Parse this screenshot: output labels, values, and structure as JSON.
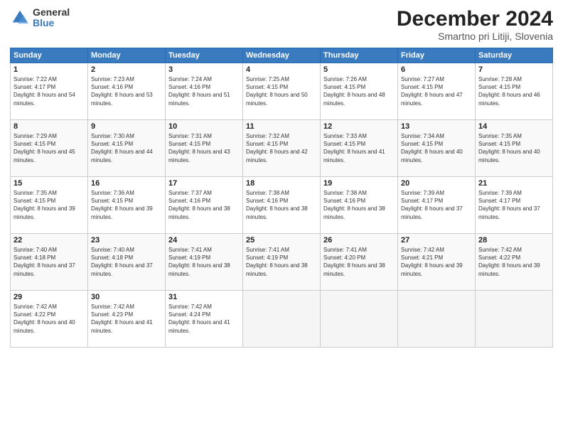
{
  "logo": {
    "general": "General",
    "blue": "Blue"
  },
  "header": {
    "month_year": "December 2024",
    "location": "Smartno pri Litiji, Slovenia"
  },
  "days_of_week": [
    "Sunday",
    "Monday",
    "Tuesday",
    "Wednesday",
    "Thursday",
    "Friday",
    "Saturday"
  ],
  "weeks": [
    [
      {
        "day": "1",
        "sunrise": "7:22 AM",
        "sunset": "4:17 PM",
        "daylight": "8 hours and 54 minutes."
      },
      {
        "day": "2",
        "sunrise": "7:23 AM",
        "sunset": "4:16 PM",
        "daylight": "8 hours and 53 minutes."
      },
      {
        "day": "3",
        "sunrise": "7:24 AM",
        "sunset": "4:16 PM",
        "daylight": "8 hours and 51 minutes."
      },
      {
        "day": "4",
        "sunrise": "7:25 AM",
        "sunset": "4:15 PM",
        "daylight": "8 hours and 50 minutes."
      },
      {
        "day": "5",
        "sunrise": "7:26 AM",
        "sunset": "4:15 PM",
        "daylight": "8 hours and 48 minutes."
      },
      {
        "day": "6",
        "sunrise": "7:27 AM",
        "sunset": "4:15 PM",
        "daylight": "8 hours and 47 minutes."
      },
      {
        "day": "7",
        "sunrise": "7:28 AM",
        "sunset": "4:15 PM",
        "daylight": "8 hours and 46 minutes."
      }
    ],
    [
      {
        "day": "8",
        "sunrise": "7:29 AM",
        "sunset": "4:15 PM",
        "daylight": "8 hours and 45 minutes."
      },
      {
        "day": "9",
        "sunrise": "7:30 AM",
        "sunset": "4:15 PM",
        "daylight": "8 hours and 44 minutes."
      },
      {
        "day": "10",
        "sunrise": "7:31 AM",
        "sunset": "4:15 PM",
        "daylight": "8 hours and 43 minutes."
      },
      {
        "day": "11",
        "sunrise": "7:32 AM",
        "sunset": "4:15 PM",
        "daylight": "8 hours and 42 minutes."
      },
      {
        "day": "12",
        "sunrise": "7:33 AM",
        "sunset": "4:15 PM",
        "daylight": "8 hours and 41 minutes."
      },
      {
        "day": "13",
        "sunrise": "7:34 AM",
        "sunset": "4:15 PM",
        "daylight": "8 hours and 40 minutes."
      },
      {
        "day": "14",
        "sunrise": "7:35 AM",
        "sunset": "4:15 PM",
        "daylight": "8 hours and 40 minutes."
      }
    ],
    [
      {
        "day": "15",
        "sunrise": "7:35 AM",
        "sunset": "4:15 PM",
        "daylight": "8 hours and 39 minutes."
      },
      {
        "day": "16",
        "sunrise": "7:36 AM",
        "sunset": "4:15 PM",
        "daylight": "8 hours and 39 minutes."
      },
      {
        "day": "17",
        "sunrise": "7:37 AM",
        "sunset": "4:16 PM",
        "daylight": "8 hours and 38 minutes."
      },
      {
        "day": "18",
        "sunrise": "7:38 AM",
        "sunset": "4:16 PM",
        "daylight": "8 hours and 38 minutes."
      },
      {
        "day": "19",
        "sunrise": "7:38 AM",
        "sunset": "4:16 PM",
        "daylight": "8 hours and 38 minutes."
      },
      {
        "day": "20",
        "sunrise": "7:39 AM",
        "sunset": "4:17 PM",
        "daylight": "8 hours and 37 minutes."
      },
      {
        "day": "21",
        "sunrise": "7:39 AM",
        "sunset": "4:17 PM",
        "daylight": "8 hours and 37 minutes."
      }
    ],
    [
      {
        "day": "22",
        "sunrise": "7:40 AM",
        "sunset": "4:18 PM",
        "daylight": "8 hours and 37 minutes."
      },
      {
        "day": "23",
        "sunrise": "7:40 AM",
        "sunset": "4:18 PM",
        "daylight": "8 hours and 37 minutes."
      },
      {
        "day": "24",
        "sunrise": "7:41 AM",
        "sunset": "4:19 PM",
        "daylight": "8 hours and 38 minutes."
      },
      {
        "day": "25",
        "sunrise": "7:41 AM",
        "sunset": "4:19 PM",
        "daylight": "8 hours and 38 minutes."
      },
      {
        "day": "26",
        "sunrise": "7:41 AM",
        "sunset": "4:20 PM",
        "daylight": "8 hours and 38 minutes."
      },
      {
        "day": "27",
        "sunrise": "7:42 AM",
        "sunset": "4:21 PM",
        "daylight": "8 hours and 39 minutes."
      },
      {
        "day": "28",
        "sunrise": "7:42 AM",
        "sunset": "4:22 PM",
        "daylight": "8 hours and 39 minutes."
      }
    ],
    [
      {
        "day": "29",
        "sunrise": "7:42 AM",
        "sunset": "4:22 PM",
        "daylight": "8 hours and 40 minutes."
      },
      {
        "day": "30",
        "sunrise": "7:42 AM",
        "sunset": "4:23 PM",
        "daylight": "8 hours and 41 minutes."
      },
      {
        "day": "31",
        "sunrise": "7:42 AM",
        "sunset": "4:24 PM",
        "daylight": "8 hours and 41 minutes."
      },
      null,
      null,
      null,
      null
    ]
  ]
}
